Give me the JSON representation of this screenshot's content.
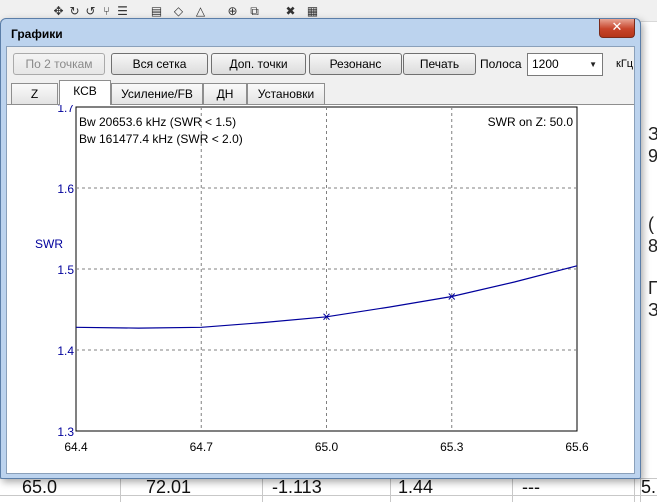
{
  "window": {
    "title": "Графики",
    "close_glyph": "✕"
  },
  "toolbar_buttons": [
    {
      "label": "По 2 точкам",
      "enabled": false
    },
    {
      "label": "Вся сетка",
      "enabled": true
    },
    {
      "label": "Доп. точки",
      "enabled": true
    },
    {
      "label": "Резонанс",
      "enabled": true
    },
    {
      "label": "Печать",
      "enabled": true
    }
  ],
  "band": {
    "label": "Полоса",
    "value": "1200",
    "unit": "кГц"
  },
  "tabs": [
    {
      "label": "Z",
      "active": false
    },
    {
      "label": "КСВ",
      "active": true
    },
    {
      "label": "Усиление/FB",
      "active": false
    },
    {
      "label": "ДН",
      "active": false
    },
    {
      "label": "Установки",
      "active": false
    }
  ],
  "background_app": {
    "cells": [
      "65.0",
      "72.01",
      "-1.113",
      "1.44",
      "---",
      "5."
    ],
    "right_fragments": [
      "З",
      "9",
      "(",
      "8",
      "П",
      "ЗА"
    ]
  },
  "chart_data": {
    "type": "line",
    "ylabel": "SWR",
    "xlim": [
      64.4,
      65.6
    ],
    "ylim": [
      1.3,
      1.7
    ],
    "x_ticks": [
      "64.4",
      "64.7",
      "65.0",
      "65.3",
      "65.6"
    ],
    "y_ticks": [
      "1.3",
      "1.4",
      "1.5",
      "1.6",
      "1.7"
    ],
    "grid": true,
    "annotations": {
      "top_left": [
        "Bw 20653.6 kHz (SWR < 1.5)",
        "Bw 161477.4 kHz (SWR < 2.0)"
      ],
      "top_right": "SWR on Z: 50.0"
    },
    "series": [
      {
        "color": "#00009c",
        "x": [
          64.4,
          64.55,
          64.7,
          64.85,
          65.0,
          65.15,
          65.3,
          65.45,
          65.6
        ],
        "y": [
          1.428,
          1.427,
          1.428,
          1.434,
          1.441,
          1.453,
          1.466,
          1.484,
          1.504
        ]
      }
    ],
    "markers": [
      {
        "x": 65.0,
        "y": 1.441
      },
      {
        "x": 65.3,
        "y": 1.466
      }
    ],
    "colors": {
      "axis_labels": "#00009c",
      "line": "#00009c",
      "grid": "#808080"
    }
  }
}
